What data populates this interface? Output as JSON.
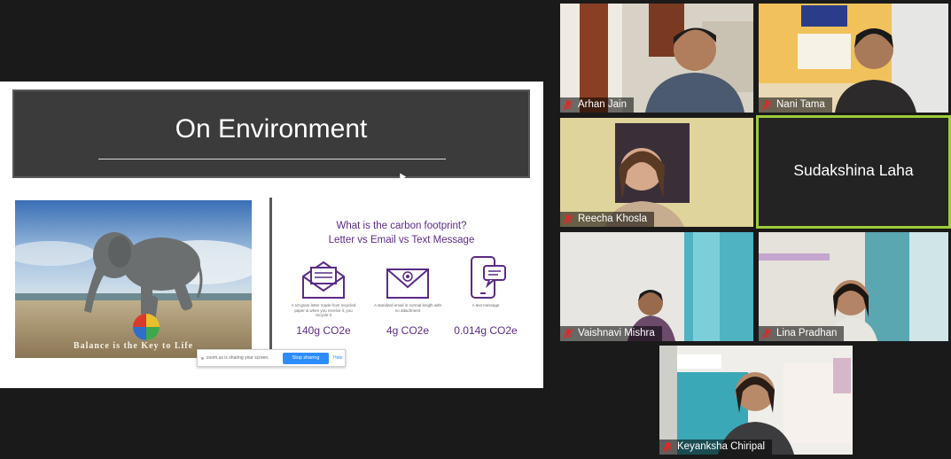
{
  "slide": {
    "title": "On Environment",
    "photo_caption": "Balance is the Key to Life",
    "footprint_title_line1": "What is the carbon footprint?",
    "footprint_title_line2": "Letter vs Email vs Text Message",
    "items": [
      {
        "icon": "letter-icon",
        "description": "A 10-gram letter made from recycled paper & when you receive it, you recycle it",
        "value": "140g CO2e"
      },
      {
        "icon": "email-icon",
        "description": "A standard email in normal length with no attachment",
        "value": "4g CO2e"
      },
      {
        "icon": "phone-message-icon",
        "description": "A text message",
        "value": "0.014g CO2e"
      }
    ]
  },
  "share_bar": {
    "status": "zoom.us is sharing your screen.",
    "stop_label": "Stop sharing",
    "hide_label": "Hide"
  },
  "participants": [
    {
      "name": "Arhan Jain",
      "muted": true
    },
    {
      "name": "Nani Tama",
      "muted": true
    },
    {
      "name": "Reecha Khosla",
      "muted": true
    },
    {
      "name": "Sudakshina Laha",
      "video": false,
      "active_speaker": true
    },
    {
      "name": "Vaishnavi Mishra",
      "muted": true
    },
    {
      "name": "Lina Pradhan",
      "muted": true
    },
    {
      "name": "Keyanksha Chiripal",
      "muted": true
    }
  ],
  "colors": {
    "accent_purple": "#5b2b86",
    "active_speaker_border": "#9ccc3a",
    "muted_mic": "#e02828",
    "stop_button": "#2d8cff"
  }
}
